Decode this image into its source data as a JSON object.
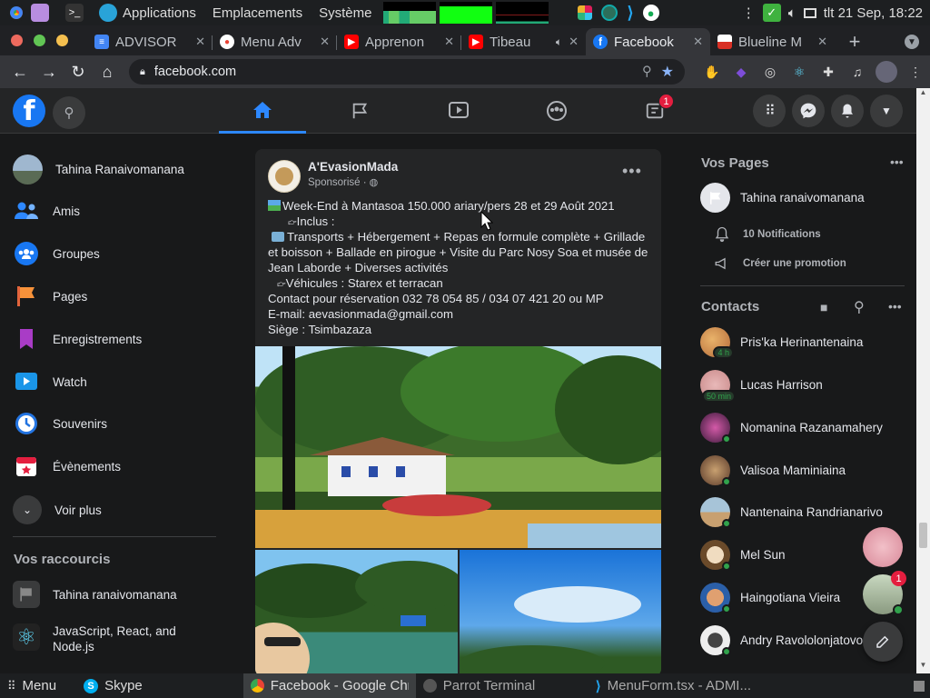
{
  "os_bar": {
    "applications": "Applications",
    "places": "Emplacements",
    "system": "Système",
    "datetime": "tlt 21 Sep, 18:22"
  },
  "tabs": [
    {
      "label": "ADVISOR",
      "icon": "docs-icon",
      "color": "#4285f4"
    },
    {
      "label": "Menu Adv",
      "icon": "recording-icon",
      "color": "#ea4335"
    },
    {
      "label": "Apprenon",
      "icon": "youtube-icon",
      "color": "#ff0000"
    },
    {
      "label": "Tibeau",
      "icon": "youtube-icon",
      "color": "#ff0000"
    },
    {
      "label": "Facebook",
      "icon": "facebook-icon",
      "color": "#1877f2"
    },
    {
      "label": "Blueline M",
      "icon": "blueline-icon",
      "color": "#d93025"
    }
  ],
  "address_bar": {
    "url": "facebook.com"
  },
  "fb_header": {
    "notif_count": "1"
  },
  "sidebar": {
    "user": "Tahina Ranaivomanana",
    "items": [
      {
        "label": "Amis",
        "icon": "friends-icon"
      },
      {
        "label": "Groupes",
        "icon": "groups-icon"
      },
      {
        "label": "Pages",
        "icon": "pages-icon"
      },
      {
        "label": "Enregistrements",
        "icon": "bookmark-icon"
      },
      {
        "label": "Watch",
        "icon": "watch-icon"
      },
      {
        "label": "Souvenirs",
        "icon": "clock-icon"
      },
      {
        "label": "Évènements",
        "icon": "calendar-icon"
      },
      {
        "label": "Voir plus",
        "icon": "chevron-down-icon"
      }
    ],
    "shortcuts_title": "Vos raccourcis",
    "shortcuts": [
      {
        "label": "Tahina ranaivomanana"
      },
      {
        "label": "JavaScript, React, and Node.js"
      }
    ]
  },
  "post": {
    "author": "A'EvasionMada",
    "sponsored": "Sponsorisé · ",
    "lines": [
      "Week-End à Mantasoa 150.000 ariary/pers  28 et 29 Août 2021",
      "Inclus :",
      "Transports + Hébergement + Repas en formule complète + Grillade et boisson + Ballade en pirogue + Visite du Parc Nosy Soa et musée de Jean Laborde + Diverses activités",
      "Véhicules : Starex et terracan",
      "Contact pour réservation  032 78 054 85 / 034 07 421 20 ou MP",
      "E-mail: aevasionmada@gmail.com",
      "Siège : Tsimbazaza"
    ]
  },
  "right": {
    "pages_title": "Vos Pages",
    "page_name": "Tahina ranaivomanana",
    "notifications": "10 Notifications",
    "create_promo": "Créer une promotion",
    "contacts_title": "Contacts",
    "contacts": [
      {
        "name": "Pris'ka Herinantenaina",
        "badge": "4 h",
        "color": "#b46a3a"
      },
      {
        "name": "Lucas Harrison",
        "badge": "50 min",
        "color": "#c98a8a"
      },
      {
        "name": "Nomanina Razanamahery",
        "badge": "",
        "color": "#6a3a6a"
      },
      {
        "name": "Valisoa Maminiaina",
        "badge": "",
        "color": "#8a6a4a"
      },
      {
        "name": "Nantenaina Randrianarivo",
        "badge": "",
        "color": "#a7c4d8"
      },
      {
        "name": "Mel Sun",
        "badge": "",
        "color": "#d8c8b0"
      },
      {
        "name": "Haingotiana Vieira",
        "badge": "",
        "color": "#2b5fa8"
      },
      {
        "name": "Andry Ravololonjatovo",
        "badge": "",
        "color": "#e8e8e8"
      }
    ],
    "chat_badge": "1"
  },
  "taskbar": {
    "menu": "Menu",
    "skype": "Skype",
    "chrome": "Facebook - Google Chr...",
    "terminal": "Parrot Terminal",
    "vscode": "MenuForm.tsx - ADMI..."
  }
}
